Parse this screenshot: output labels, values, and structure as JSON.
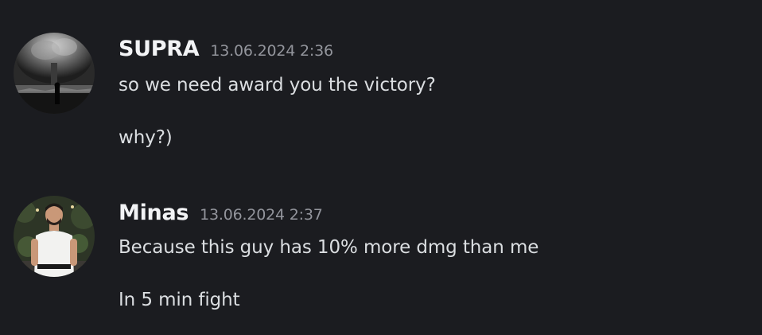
{
  "messages": [
    {
      "username": "SUPRA",
      "timestamp": "13.06.2024 2:36",
      "avatar": "dark-smoke-figure-avatar",
      "lines": [
        "so we need award you the victory?",
        "why?)"
      ]
    },
    {
      "username": "Minas",
      "timestamp": "13.06.2024 2:37",
      "avatar": "man-white-shirt-avatar",
      "lines": [
        "Because this guy has 10% more dmg than me",
        "In 5 min fight"
      ]
    }
  ],
  "colors": {
    "background": "#1b1c20",
    "username": "#f2f3f5",
    "timestamp": "#93959c",
    "message_text": "#dbdee1"
  }
}
